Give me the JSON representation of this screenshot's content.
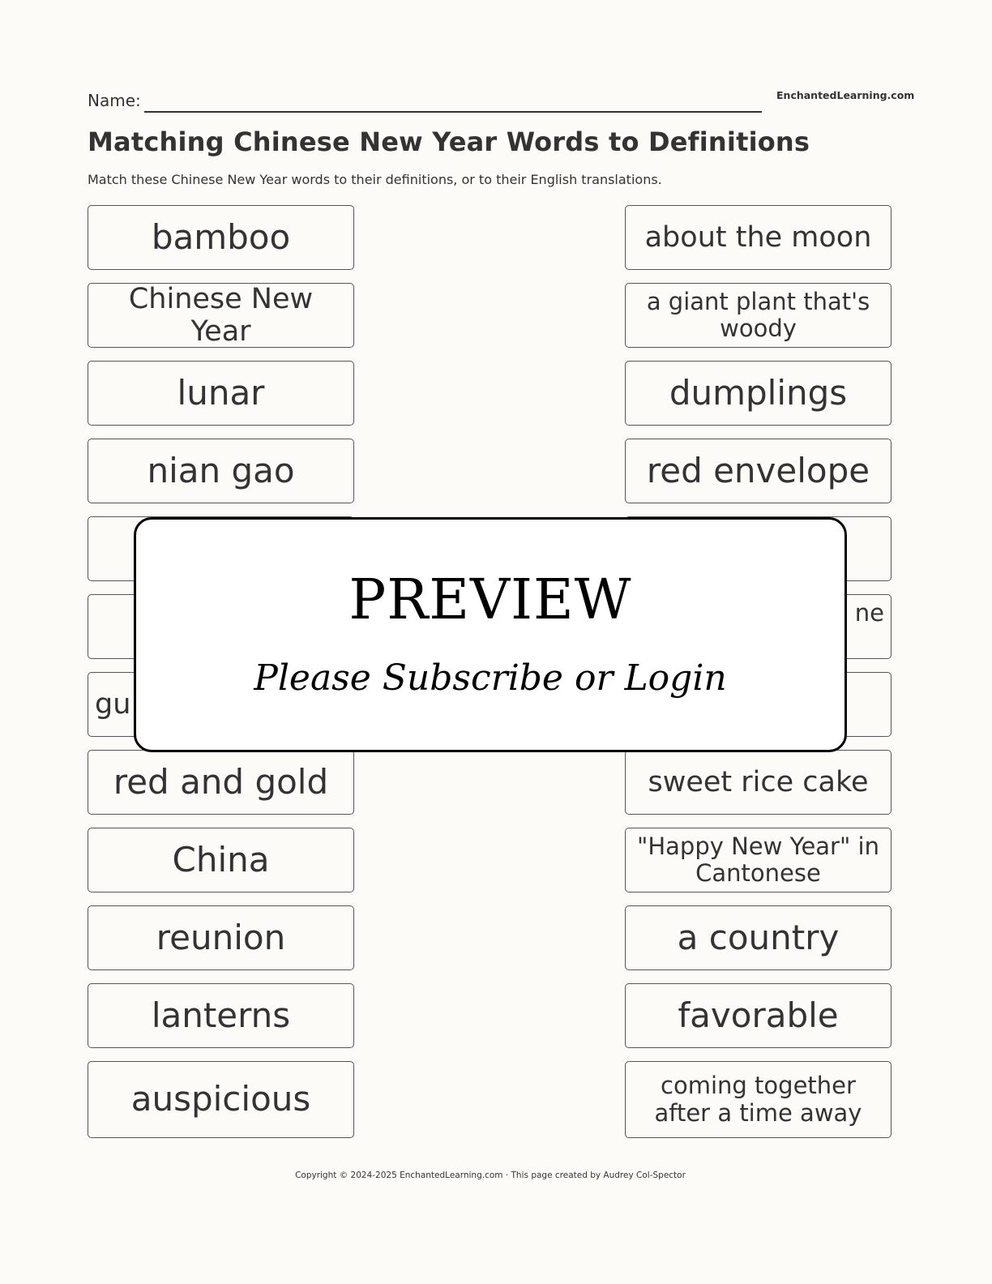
{
  "header": {
    "name_label": "Name:",
    "site": "EnchantedLearning.com",
    "title": "Matching Chinese New Year Words to Definitions",
    "subtitle": "Match these Chinese New Year words to their definitions, or to their English translations."
  },
  "left_words": [
    "bamboo",
    "Chinese New Year",
    "lunar",
    "nian gao",
    "",
    "",
    "gu",
    "red and gold",
    "China",
    "reunion",
    "lanterns",
    "auspicious"
  ],
  "right_definitions": [
    "about the moon",
    "a giant plant that's woody",
    "dumplings",
    "red envelope",
    "",
    "ne",
    "",
    "sweet rice cake",
    "\"Happy New Year\" in Cantonese",
    "a country",
    "favorable",
    "coming together after a time away"
  ],
  "overlay": {
    "heading": "PREVIEW",
    "message": "Please Subscribe or Login"
  },
  "footer": "Copyright © 2024-2025 EnchantedLearning.com · This page created by Audrey Col-Spector"
}
